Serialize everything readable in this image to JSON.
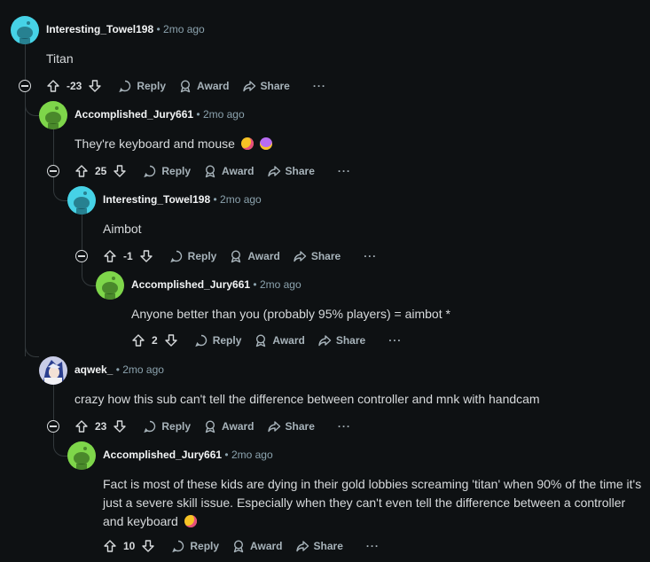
{
  "colors": {
    "background": "#0e1113",
    "thread_line": "#33393c",
    "avatar_cyan": "#46d2e6",
    "avatar_green": "#7ed64a"
  },
  "comments": [
    {
      "username": "Interesting_Towel198",
      "meta": "• 2mo ago",
      "avatar": "snoo-cyan-avatar",
      "body": "Titan",
      "votes": "-23",
      "reply_label": "Reply",
      "award_label": "Award",
      "share_label": "Share",
      "more_label": "···"
    },
    {
      "username": "Accomplished_Jury661",
      "meta": "• 2mo ago",
      "avatar": "snoo-green-avatar",
      "body": "They're keyboard and mouse",
      "emojis": [
        "rofl-emoji",
        "scream-emoji"
      ],
      "votes": "25",
      "reply_label": "Reply",
      "award_label": "Award",
      "share_label": "Share",
      "more_label": "···"
    },
    {
      "username": "Interesting_Towel198",
      "meta": "• 2mo ago",
      "avatar": "snoo-cyan-avatar",
      "body": "Aimbot",
      "votes": "-1",
      "reply_label": "Reply",
      "award_label": "Award",
      "share_label": "Share",
      "more_label": "···"
    },
    {
      "username": "Accomplished_Jury661",
      "meta": "• 2mo ago",
      "avatar": "snoo-green-avatar",
      "body": "Anyone better than you (probably 95% players) = aimbot *",
      "votes": "2",
      "reply_label": "Reply",
      "award_label": "Award",
      "share_label": "Share",
      "more_label": "···"
    },
    {
      "username": "aqwek_",
      "meta": "• 2mo ago",
      "avatar": "anime-avatar",
      "body": "crazy how this sub can't tell the difference between controller and mnk with handcam",
      "votes": "23",
      "reply_label": "Reply",
      "award_label": "Award",
      "share_label": "Share",
      "more_label": "···"
    },
    {
      "username": "Accomplished_Jury661",
      "meta": "• 2mo ago",
      "avatar": "snoo-green-avatar",
      "body": "Fact is most of these kids are dying in their gold lobbies screaming 'titan' when 90% of the time it's just a severe skill issue. Especially when they can't even tell the difference between a controller and keyboard",
      "emojis": [
        "rofl-emoji"
      ],
      "votes": "10",
      "reply_label": "Reply",
      "award_label": "Award",
      "share_label": "Share",
      "more_label": "···"
    }
  ]
}
